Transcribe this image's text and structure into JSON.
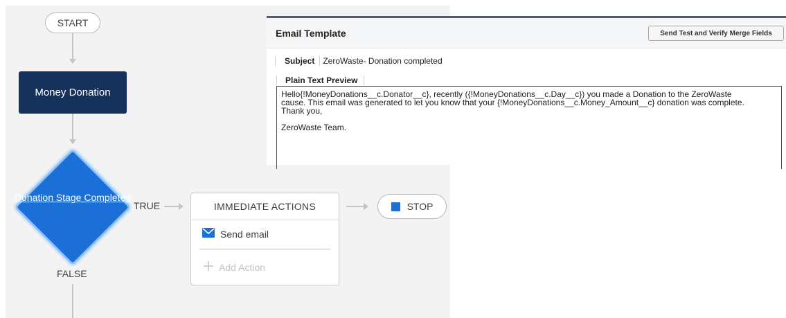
{
  "flow": {
    "start_label": "START",
    "money_donation_label": "Money Donation",
    "decision_label": "Donation Stage Completed",
    "true_label": "TRUE",
    "false_label": "FALSE",
    "immediate_actions_header": "IMMEDIATE ACTIONS",
    "action_send_email": "Send email",
    "add_action_label": "Add Action",
    "stop_label": "STOP",
    "colors": {
      "primary_dark": "#16325c",
      "accent_blue": "#1b6fd6",
      "canvas_bg": "#f3f3f3"
    },
    "icons": [
      "envelope-icon",
      "plus-icon",
      "stop-square-icon"
    ]
  },
  "email_template": {
    "title": "Email Template",
    "test_button_label": "Send Test and Verify Merge Fields",
    "subject_label": "Subject",
    "subject_value": "ZeroWaste- Donation completed",
    "plain_text_label": "Plain Text Preview",
    "body_lines": [
      "Hello{!MoneyDonations__c.Donator__c}, recently ({!MoneyDonations__c.Day__c}) you made a Donation to the ZeroWaste",
      "cause. This email was generated to let you know that your {!MoneyDonations__c.Money_Amount__c} donation was complete.",
      "Thank you,",
      "",
      "ZeroWaste Team."
    ]
  }
}
